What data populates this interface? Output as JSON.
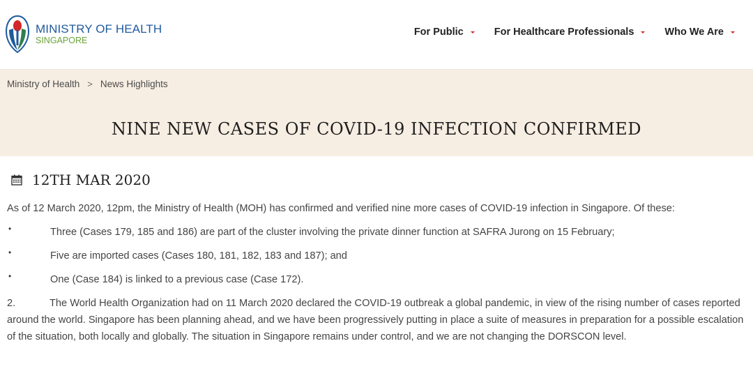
{
  "header": {
    "logo": {
      "title": "MINISTRY OF HEALTH",
      "subtitle": "SINGAPORE"
    },
    "nav": [
      {
        "label": "For Public"
      },
      {
        "label": "For Healthcare Professionals"
      },
      {
        "label": "Who We Are"
      }
    ],
    "colors": {
      "brand_blue": "#1f5a9e",
      "brand_green": "#6aa33b",
      "caret_red": "#d3272a"
    }
  },
  "breadcrumb": {
    "home": "Ministry of Health",
    "separator": ">",
    "current": "News Highlights"
  },
  "article": {
    "title": "NINE NEW CASES OF COVID-19 INFECTION CONFIRMED",
    "date": "12TH MAR 2020",
    "intro": "As of 12 March 2020, 12pm, the Ministry of Health (MOH) has confirmed and verified nine more cases of COVID-19 infection in Singapore. Of these:",
    "bullet_symbol": "•",
    "bullets": [
      "Three (Cases 179, 185 and 186) are part of the cluster involving the private dinner function at SAFRA Jurong on 15 February;",
      "Five are imported cases (Cases 180, 181, 182, 183 and 187); and",
      "One (Case 184) is linked to a previous case (Case 172)."
    ],
    "paragraph2": {
      "number": "2.",
      "text": "The World Health Organization had on 11 March 2020 declared the COVID-19 outbreak a global pandemic, in view of the rising number of cases reported around the world. Singapore has been planning ahead, and we have been progressively putting in place a suite of measures in preparation for a possible escalation of the situation, both locally and globally. The situation in Singapore remains under control, and we are not changing the DORSCON level."
    }
  },
  "icons": {
    "logo": "moh-logo-icon",
    "date": "calendar-icon",
    "nav_caret": "caret-down-icon"
  },
  "banner_color": "#f7eee3"
}
